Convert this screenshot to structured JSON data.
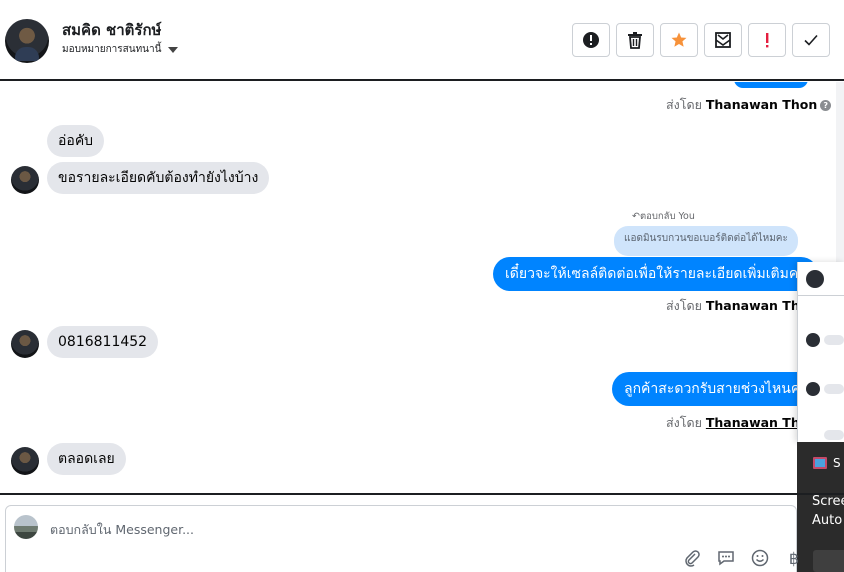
{
  "header": {
    "contact_name": "สมคิด ชาติรักษ์",
    "assign_label": "มอบหมายการสนทนานี้",
    "toolbar": [
      {
        "name": "alert-circle-icon"
      },
      {
        "name": "trash-icon"
      },
      {
        "name": "star-icon",
        "color": "#f7923a"
      },
      {
        "name": "mark-unread-icon"
      },
      {
        "name": "exclamation-icon",
        "color": "#e41e3f"
      },
      {
        "name": "check-icon"
      }
    ]
  },
  "messages": {
    "sent_by_prefix": "ส่งโดย",
    "sender_name": "Thanawan Thon",
    "incoming_1": "อ่อคับ",
    "incoming_2": "ขอรายละเอียดคับต้องทำยังไงบ้าง",
    "reply_note": "ตอบกลับ You",
    "reply_quote": "แอดมินรบกวนขอเบอร์ติดต่อได้ไหมคะ",
    "outgoing_1": "เดี๋ยวจะให้เซลล์ติดต่อเพื่อให้รายละเอียดเพิ่มเติมคะ",
    "incoming_3": "0816811452",
    "outgoing_2": "ลูกค้าสะดวกรับสายช่วงไหนคะ",
    "incoming_4": "ตลอดเลย"
  },
  "toast": {
    "title": "S",
    "line1": "Scree",
    "line2": "Auto"
  },
  "composer": {
    "placeholder": "ตอบกลับใน Messenger..."
  },
  "colors": {
    "outgoing_bubble": "#0084ff",
    "incoming_bubble": "#e4e6eb",
    "quote_bubble": "#cfe4fb"
  }
}
